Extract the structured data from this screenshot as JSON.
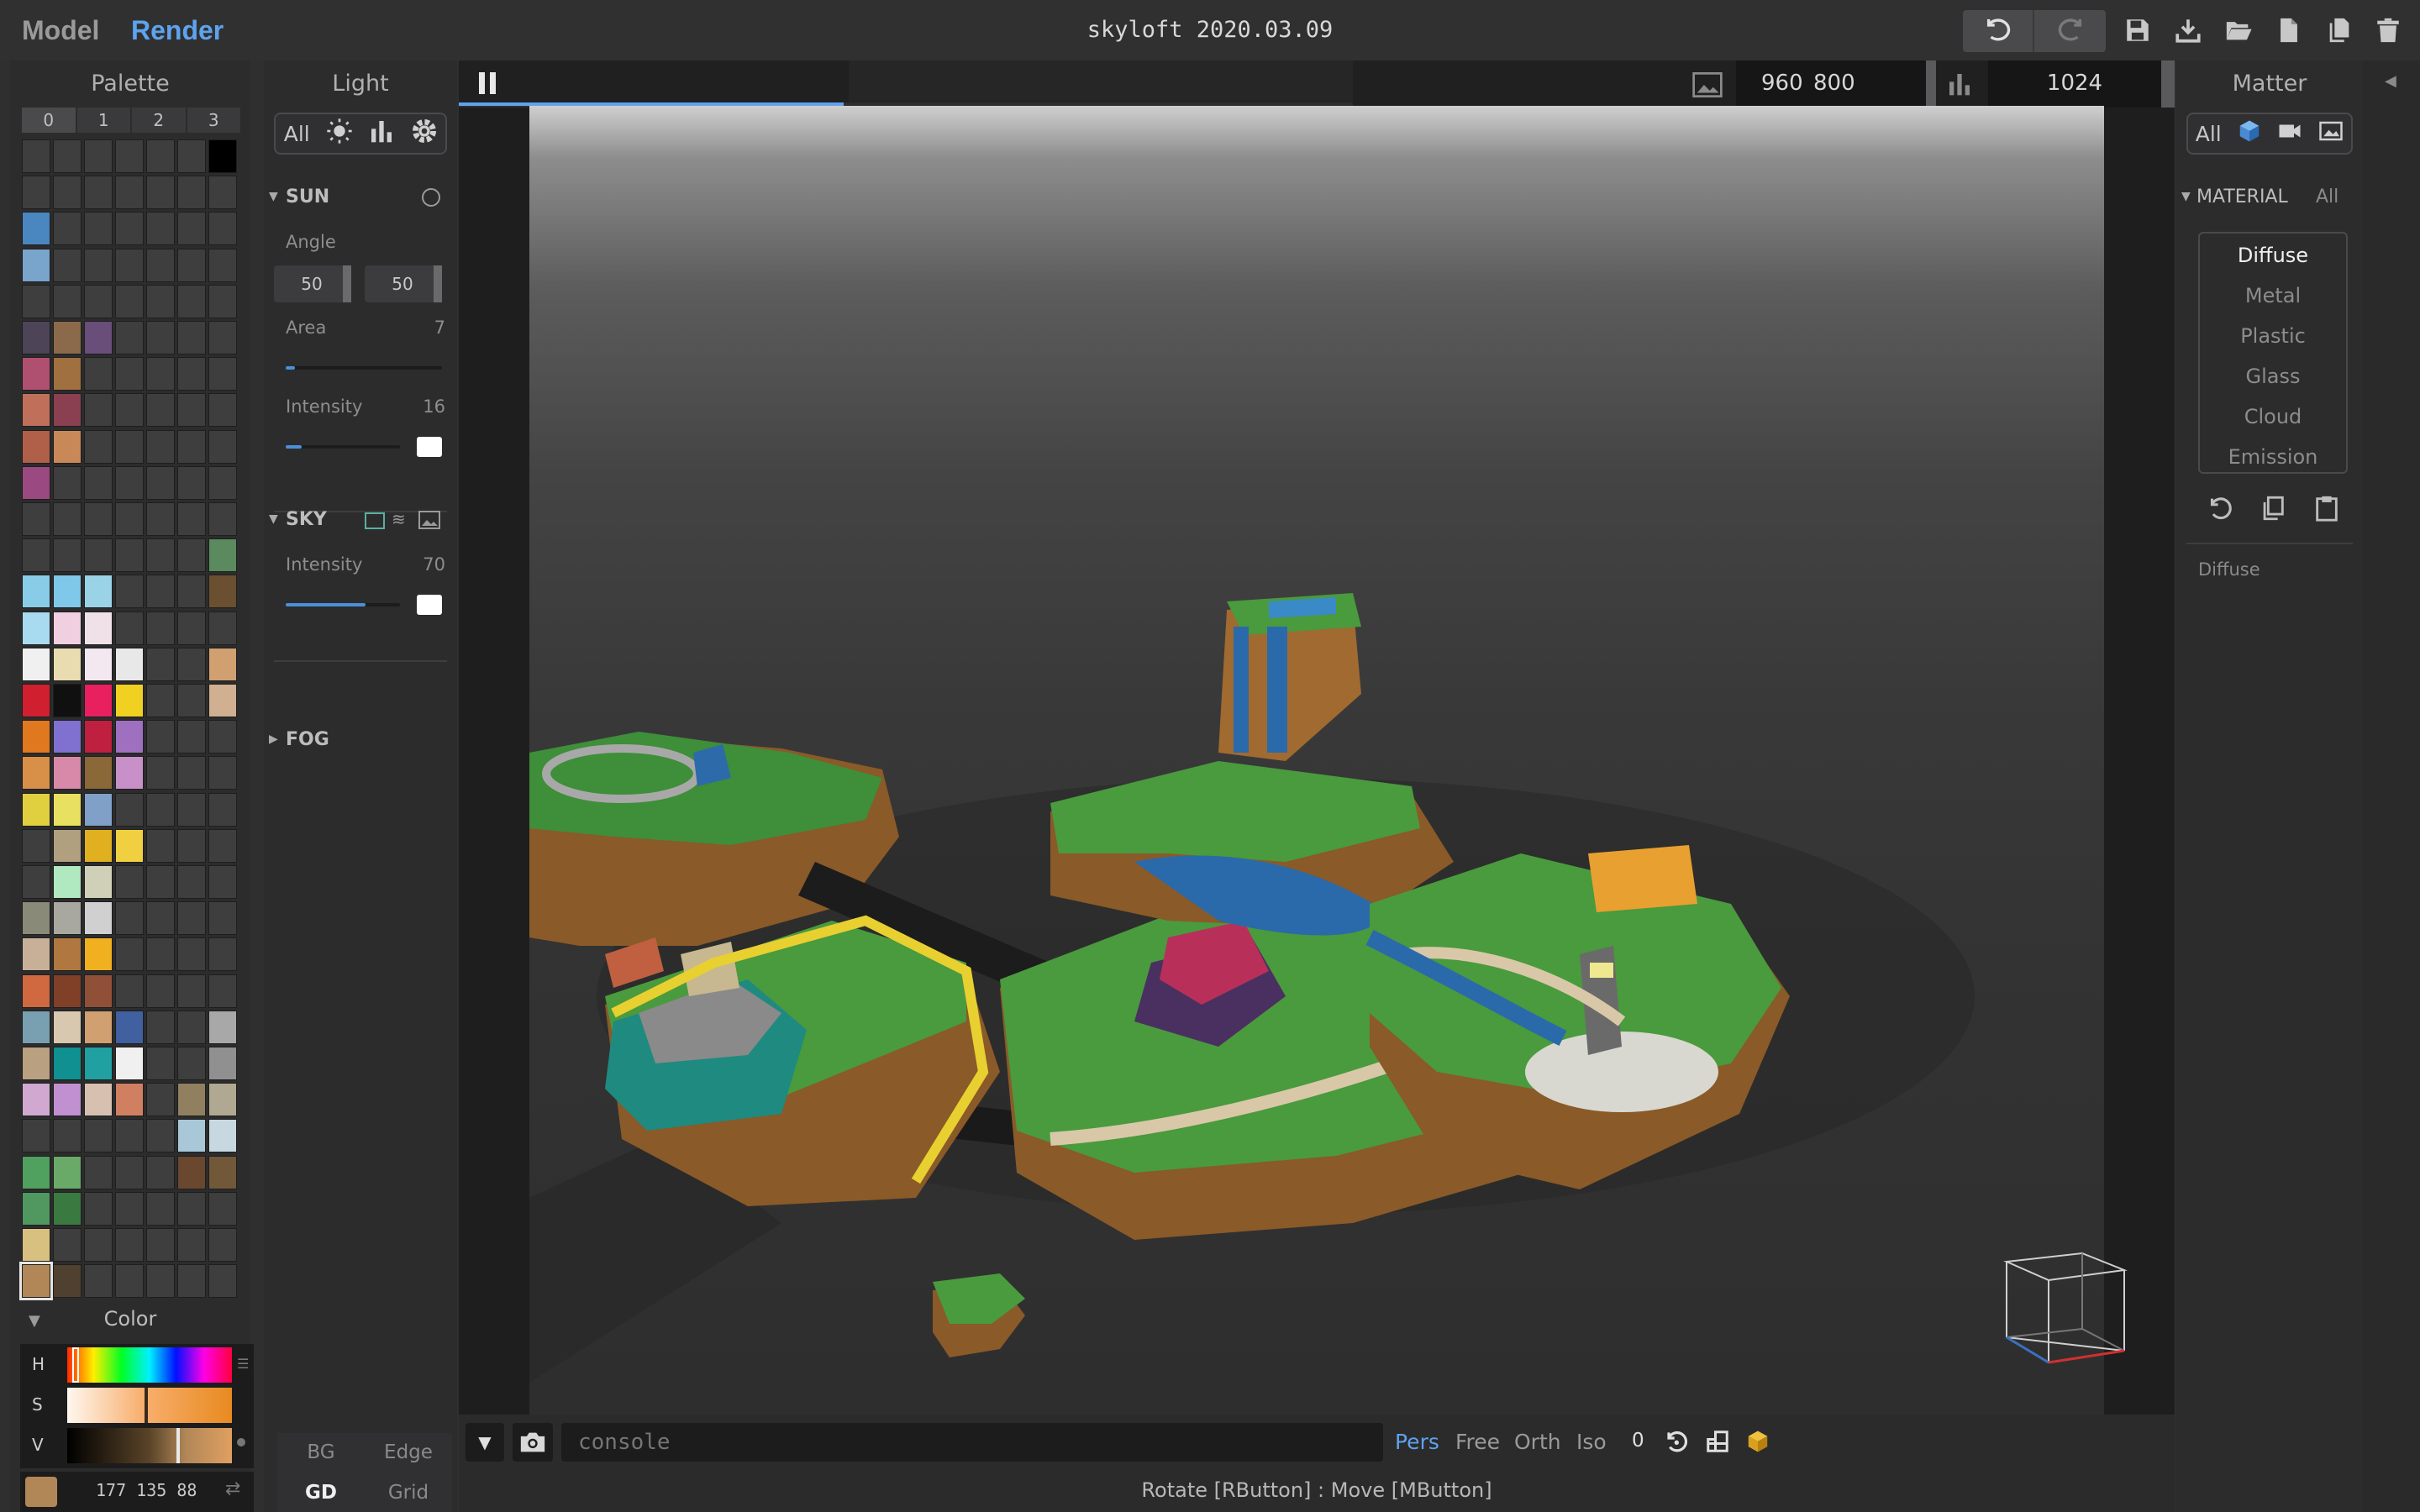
{
  "topbar": {
    "tab_model": "Model",
    "tab_render": "Render",
    "file_title": "skyloft 2020.03.09",
    "icons": [
      "undo-icon",
      "redo-icon",
      "save-icon",
      "export-icon",
      "open-folder-icon",
      "new-file-icon",
      "duplicate-icon",
      "delete-icon"
    ]
  },
  "palette": {
    "title": "Palette",
    "columns": [
      "0",
      "1",
      "2",
      "3"
    ],
    "rows": [
      [
        "#3e3e3e",
        "#3e3e3e",
        "#3e3e3e",
        "#3e3e3e",
        "#3e3e3e",
        "#3e3e3e",
        "#000000"
      ],
      [
        "#3e3e3e",
        "#3e3e3e",
        "#3e3e3e",
        "#3e3e3e",
        "#3e3e3e",
        "#3e3e3e",
        "#3e3e3e"
      ],
      [
        "#4a86c0",
        "#3e3e3e",
        "#3e3e3e",
        "#3e3e3e",
        "#3e3e3e",
        "#3e3e3e",
        "#3e3e3e"
      ],
      [
        "#79a4cc",
        "#3e3e3e",
        "#3e3e3e",
        "#3e3e3e",
        "#3e3e3e",
        "#3e3e3e",
        "#3e3e3e"
      ],
      [
        "#3e3e3e",
        "#3e3e3e",
        "#3e3e3e",
        "#3e3e3e",
        "#3e3e3e",
        "#3e3e3e",
        "#3e3e3e"
      ],
      [
        "#4e4458",
        "#8a6a4a",
        "#6a4e7a",
        "#3e3e3e",
        "#3e3e3e",
        "#3e3e3e",
        "#3e3e3e"
      ],
      [
        "#b05070",
        "#a07040",
        "#3e3e3e",
        "#3e3e3e",
        "#3e3e3e",
        "#3e3e3e",
        "#3e3e3e"
      ],
      [
        "#c0705a",
        "#8a4050",
        "#3e3e3e",
        "#3e3e3e",
        "#3e3e3e",
        "#3e3e3e",
        "#3e3e3e"
      ],
      [
        "#b06048",
        "#c88858",
        "#3e3e3e",
        "#3e3e3e",
        "#3e3e3e",
        "#3e3e3e",
        "#3e3e3e"
      ],
      [
        "#9a4a80",
        "#3e3e3e",
        "#3e3e3e",
        "#3e3e3e",
        "#3e3e3e",
        "#3e3e3e",
        "#3e3e3e"
      ],
      [
        "#3e3e3e",
        "#3e3e3e",
        "#3e3e3e",
        "#3e3e3e",
        "#3e3e3e",
        "#3e3e3e",
        "#3e3e3e"
      ],
      [
        "#3e3e3e",
        "#3e3e3e",
        "#3e3e3e",
        "#3e3e3e",
        "#3e3e3e",
        "#3e3e3e",
        "#5a8a5e"
      ],
      [
        "#88cce8",
        "#80c8ea",
        "#9ad2e8",
        "#3e3e3e",
        "#3e3e3e",
        "#3e3e3e",
        "#6a5030"
      ],
      [
        "#a8daf0",
        "#f0d0e0",
        "#f0e0e8",
        "#3e3e3e",
        "#3e3e3e",
        "#3e3e3e",
        "#3e3e3e"
      ],
      [
        "#f0f0f0",
        "#e8dcb0",
        "#f4e8f0",
        "#e8e8e8",
        "#3e3e3e",
        "#3e3e3e",
        "#d0a070"
      ],
      [
        "#d02030",
        "#101010",
        "#e82060",
        "#f0d020",
        "#3e3e3e",
        "#3e3e3e",
        "#d0b090"
      ],
      [
        "#e07820",
        "#8070d0",
        "#c02040",
        "#a070c0",
        "#3e3e3e",
        "#3e3e3e",
        "#3e3e3e"
      ],
      [
        "#d89048",
        "#d888a8",
        "#8a6838",
        "#c890c8",
        "#3e3e3e",
        "#3e3e3e",
        "#3e3e3e"
      ],
      [
        "#e0d040",
        "#e8e060",
        "#80a0c8",
        "#3e3e3e",
        "#3e3e3e",
        "#3e3e3e",
        "#3e3e3e"
      ],
      [
        "#3e3e3e",
        "#b0a080",
        "#e0b020",
        "#f0d040",
        "#3e3e3e",
        "#3e3e3e",
        "#3e3e3e"
      ],
      [
        "#3e3e3e",
        "#b0e8c0",
        "#d0d0b8",
        "#3e3e3e",
        "#3e3e3e",
        "#3e3e3e",
        "#3e3e3e"
      ],
      [
        "#8a8a78",
        "#a8a8a0",
        "#d0d0d0",
        "#3e3e3e",
        "#3e3e3e",
        "#3e3e3e",
        "#3e3e3e"
      ],
      [
        "#c8b098",
        "#b07840",
        "#f0b020",
        "#3e3e3e",
        "#3e3e3e",
        "#3e3e3e",
        "#3e3e3e"
      ],
      [
        "#d06840",
        "#804028",
        "#905038",
        "#3e3e3e",
        "#3e3e3e",
        "#3e3e3e",
        "#3e3e3e"
      ],
      [
        "#78a0b0",
        "#d8c8b0",
        "#d0a070",
        "#4060a0",
        "#3e3e3e",
        "#3e3e3e",
        "#a8a8a8"
      ],
      [
        "#b8a080",
        "#109090",
        "#20a0a0",
        "#f0f0f0",
        "#3e3e3e",
        "#3e3e3e",
        "#909090"
      ],
      [
        "#d0a8d0",
        "#c090d0",
        "#d8c0b0",
        "#d08060",
        "#3e3e3e",
        "#908060",
        "#b0a890"
      ],
      [
        "#3e3e3e",
        "#3e3e3e",
        "#3e3e3e",
        "#3e3e3e",
        "#3e3e3e",
        "#a8c8d8",
        "#c8d8e0"
      ],
      [
        "#50a060",
        "#6aaa68",
        "#3e3e3e",
        "#3e3e3e",
        "#3e3e3e",
        "#6a4830",
        "#705838"
      ],
      [
        "#509860",
        "#3a7a40",
        "#3e3e3e",
        "#3e3e3e",
        "#3e3e3e",
        "#3e3e3e",
        "#3e3e3e"
      ],
      [
        "#d8c080",
        "#3e3e3e",
        "#3e3e3e",
        "#3e3e3e",
        "#3e3e3e",
        "#3e3e3e",
        "#3e3e3e"
      ],
      [
        "#b18758",
        "#504030",
        "#3e3e3e",
        "#3e3e3e",
        "#3e3e3e",
        "#3e3e3e",
        "#3e3e3e"
      ]
    ],
    "selected_color": "#b18758"
  },
  "color_panel": {
    "title": "Color",
    "h_label": "H",
    "s_label": "S",
    "v_label": "V",
    "rgb_value": "177 135 88",
    "swatch": "#b18758"
  },
  "bg_edge": {
    "bg": "BG",
    "edge": "Edge",
    "gd": "GD",
    "grid": "Grid"
  },
  "light": {
    "title": "Light",
    "filter_all": "All",
    "sun": {
      "label": "SUN",
      "angle_label": "Angle",
      "angle_1": "50",
      "angle_2": "50",
      "area_label": "Area",
      "area_value": "7",
      "area_fraction": 0.06,
      "intensity_label": "Intensity",
      "intensity_value": "16",
      "intensity_fraction": 0.14
    },
    "sky": {
      "label": "SKY",
      "intensity_label": "Intensity",
      "intensity_value": "70",
      "intensity_fraction": 0.7
    },
    "fog": {
      "label": "FOG"
    }
  },
  "render": {
    "width": "960",
    "height": "800",
    "samples": "1024",
    "progress": 0.43
  },
  "matter": {
    "title": "Matter",
    "filter_all": "All",
    "material_label": "MATERIAL",
    "material_filter": "All",
    "materials": [
      "Diffuse",
      "Metal",
      "Plastic",
      "Glass",
      "Cloud",
      "Emission"
    ],
    "selected": "Diffuse",
    "current_label": "Diffuse"
  },
  "bottom": {
    "console_placeholder": "console",
    "camera_modes": [
      "Pers",
      "Free",
      "Orth",
      "Iso"
    ],
    "active_mode": "Pers",
    "fov_value": "0",
    "status": "Rotate [RButton] : Move [MButton]"
  },
  "colors": {
    "accent": "#5ea3ee",
    "panel": "#2c2c2d",
    "background": "#232324"
  }
}
